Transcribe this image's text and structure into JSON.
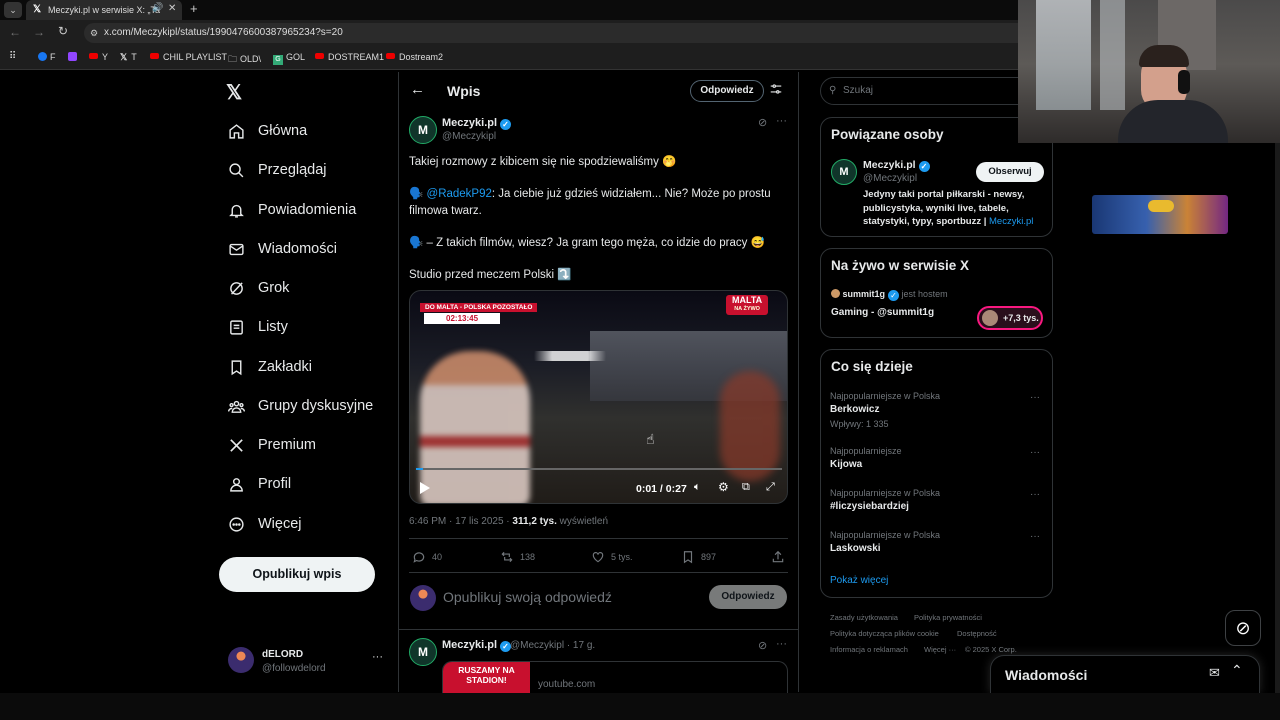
{
  "browser": {
    "tab_title": "Meczyki.pl w serwisie X: „Ta",
    "url": "x.com/Meczykipl/status/1990476600387965234?s=20",
    "bookmarks": [
      "F",
      "",
      "Y",
      "T",
      "CHIL PLAYLIST",
      "OLD\\",
      "GOL",
      "DOSTREAM1",
      "Dostream2"
    ]
  },
  "sidebar": {
    "items": [
      {
        "label": "Główna",
        "icon": "home-icon"
      },
      {
        "label": "Przeglądaj",
        "icon": "search-icon"
      },
      {
        "label": "Powiadomienia",
        "icon": "bell-icon"
      },
      {
        "label": "Wiadomości",
        "icon": "mail-icon"
      },
      {
        "label": "Grok",
        "icon": "grok-icon"
      },
      {
        "label": "Listy",
        "icon": "list-icon"
      },
      {
        "label": "Zakładki",
        "icon": "bookmark-icon"
      },
      {
        "label": "Grupy dyskusyjne",
        "icon": "communities-icon"
      },
      {
        "label": "Premium",
        "icon": "x-logo-icon"
      },
      {
        "label": "Profil",
        "icon": "person-icon"
      },
      {
        "label": "Więcej",
        "icon": "more-circle-icon"
      }
    ],
    "post_button": "Opublikuj wpis",
    "account": {
      "name": "dELORD",
      "handle": "@followdelord"
    }
  },
  "header": {
    "title": "Wpis",
    "reply_button": "Odpowiedz"
  },
  "post": {
    "author": "Meczyki.pl",
    "handle": "@Meczykipl",
    "line1": "Takiej rozmowy z kibicem się nie spodziewaliśmy 🤭",
    "line2_prefix": "🗣️ ",
    "line2_mention": "@RadekP92",
    "line2_rest": ": Ja ciebie już gdzieś widziałem... Nie? Może po prostu filmowa twarz.",
    "line3": "🗣️ – Z takich filmów, wiesz? Ja gram tego męża, co idzie do pracy 😅",
    "line4": "Studio przed meczem Polski ⤵️",
    "video": {
      "overlay_top": "DO MALTA - POLSKA POZOSTAŁO",
      "countdown": "02:13:45",
      "logo": "MALTA",
      "logo_sub": "NA ŻYWO",
      "time": "0:01 / 0:27",
      "progress": 0.02
    },
    "time": "6:46 PM",
    "date": "17 lis 2025",
    "views": "311,2 tys.",
    "views_label": "wyświetleń",
    "stats": {
      "replies": "40",
      "reposts": "138",
      "likes": "5 tys.",
      "bookmarks": "897"
    }
  },
  "reply_box": {
    "placeholder": "Opublikuj swoją odpowiedź",
    "button": "Odpowiedz"
  },
  "next_post": {
    "author": "Meczyki.pl",
    "meta": "@Meczykipl · 17 g.",
    "thumb_text": "RUSZAMY NA STADION!",
    "link": "youtube.com"
  },
  "right": {
    "search_placeholder": "Szukaj",
    "related": {
      "title": "Powiązane osoby",
      "name": "Meczyki.pl",
      "handle": "@Meczykipl",
      "follow": "Obserwuj",
      "bio": "Jedyny taki portal piłkarski - newsy, publicystyka, wyniki live, tabele, statystyki, typy, sportbuzz |",
      "bio_link": "Meczyki.pl"
    },
    "live": {
      "title": "Na żywo w serwisie X",
      "host": "summit1g",
      "host_suffix": "jest hostem",
      "name": "Gaming - @summit1g",
      "listeners": "+7,3 tys."
    },
    "trends": {
      "title": "Co się dzieje",
      "items": [
        {
          "context": "Najpopularniejsze w Polska",
          "name": "Berkowicz",
          "posts": "Wpływy: 1 335"
        },
        {
          "context": "Najpopularniejsze",
          "name": "Kijowa",
          "posts": ""
        },
        {
          "context": "Najpopularniejsze w Polska",
          "name": "#liczysiebardziej",
          "posts": ""
        },
        {
          "context": "Najpopularniejsze w Polska",
          "name": "Laskowski",
          "posts": ""
        }
      ],
      "show_more": "Pokaż więcej"
    },
    "footer": {
      "l1a": "Zasady użytkowania",
      "l1b": "Polityka prywatności",
      "l2a": "Polityka dotycząca plików cookie",
      "l2b": "Dostępność",
      "l3a": "Informacja o reklamach",
      "l3b": "Więcej ···",
      "l3c": "© 2025 X Corp."
    }
  },
  "messages_drawer": {
    "title": "Wiadomości"
  },
  "colors": {
    "accent": "#1d9bf0",
    "bg": "#000000",
    "border": "#2f3336",
    "muted": "#71767b"
  }
}
